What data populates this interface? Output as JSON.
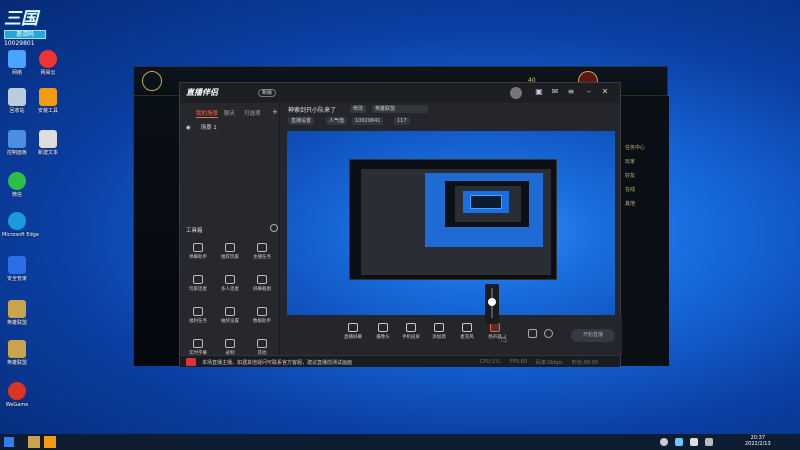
{
  "desktop": {
    "logo": {
      "title": "三国",
      "badge": "邀请码",
      "code": "10029801"
    },
    "icons": [
      {
        "label": "网络",
        "color": "#4aa3ff"
      },
      {
        "label": "回收站",
        "color": "#bcd"
      },
      {
        "label": "控制面板",
        "color": "#4a8fe0"
      },
      {
        "label": "此电脑",
        "color": "#6cb0f0"
      },
      {
        "label": "微信",
        "color": "#2bbf4a"
      },
      {
        "label": "Microsoft Edge",
        "color": "#1a9bdc"
      },
      {
        "label": "安全管家",
        "color": "#2b6ee8"
      },
      {
        "label": "英雄联盟",
        "color": "#c9a44a"
      },
      {
        "label": "英雄联盟",
        "color": "#c9a44a"
      },
      {
        "label": "WeGame",
        "color": "#dd3322"
      }
    ],
    "icons2": [
      {
        "label": "网易云",
        "color": "#e33"
      },
      {
        "label": "安装工具",
        "color": "#f39c12"
      },
      {
        "label": "新建文本",
        "color": "#ddd"
      }
    ]
  },
  "lol": {
    "currency": "40",
    "right_items": [
      "任务中心",
      "玩家",
      "好友",
      "在线",
      "其他"
    ]
  },
  "app": {
    "title": "直播伴侣",
    "version": "新版",
    "left_tabs": [
      "我的场景",
      "聊天",
      "可选项"
    ],
    "scene_name": "场景 1",
    "tools_title": "工具箱",
    "tools": [
      "弹幕助手",
      "推荐玩家",
      "主播任务",
      "玩家连麦",
      "多人连麦",
      "屏幕截图",
      "福利任务",
      "抽奖设置",
      "数据助手",
      "实时字幕",
      "录制",
      "其他"
    ],
    "room_title": "神索剑只小队来了",
    "edit_label": "修改",
    "game_tag": "英雄联盟",
    "chips": [
      "直播设置",
      "人气值",
      "10029841",
      "117"
    ],
    "bottom_buttons": [
      "直播屏幕",
      "摄像头",
      "手机投屏",
      "添加源",
      "麦克风",
      "扬声器"
    ],
    "start_label": "开始直播",
    "status_text": "本场直播主播，如遇其他疑问可联系官方客服，建议直播前测试画面",
    "status_right": [
      "CPU:1%",
      "FPS:60",
      "码率:0kbps",
      "时长:00:00"
    ]
  },
  "taskbar": {
    "time": "20:37",
    "date": "2022/2/13"
  }
}
